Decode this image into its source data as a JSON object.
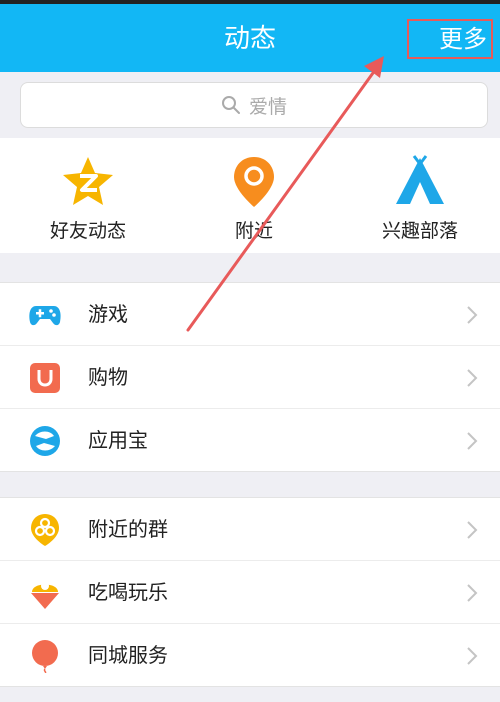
{
  "header": {
    "title": "动态",
    "more_label": "更多"
  },
  "search": {
    "placeholder": "爱情"
  },
  "quick_links": [
    {
      "label": "好友动态",
      "icon": "star-z-icon"
    },
    {
      "label": "附近",
      "icon": "location-pin-icon"
    },
    {
      "label": "兴趣部落",
      "icon": "tent-icon"
    }
  ],
  "section1": [
    {
      "label": "游戏",
      "icon": "gamepad-icon"
    },
    {
      "label": "购物",
      "icon": "shopping-bag-icon"
    },
    {
      "label": "应用宝",
      "icon": "app-store-icon"
    }
  ],
  "section2": [
    {
      "label": "附近的群",
      "icon": "nearby-group-icon"
    },
    {
      "label": "吃喝玩乐",
      "icon": "ice-cream-icon"
    },
    {
      "label": "同城服务",
      "icon": "balloon-icon"
    }
  ],
  "colors": {
    "header_bg": "#12b7f5",
    "annotation_red": "#e85a5a",
    "star_yellow": "#f7b500",
    "pin_orange": "#f78d1e",
    "tent_blue": "#1ea7e8"
  }
}
